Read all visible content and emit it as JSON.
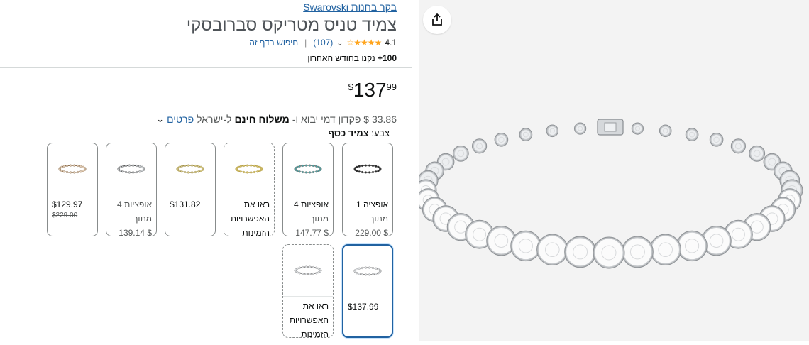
{
  "store_link": "בקר בחנות Swarovski",
  "title": "צמיד טניס מטריקס סברובסקי",
  "rating": {
    "value": "4.1",
    "stars": "★★★★☆",
    "count": "(107)",
    "search_link": "חיפוש בדף זה"
  },
  "bought": {
    "count": "100+",
    "text": "נקנו בחודש האחרון"
  },
  "price": {
    "symbol": "$",
    "whole": "137",
    "fraction": "99"
  },
  "delivery": {
    "deposit": "33.86 $ פקדון דמי יבוא ו-",
    "free_shipping": "משלוח חינם",
    "to_israel": "ל-ישראל",
    "details_link": "פרטים"
  },
  "color": {
    "label": "צבע:",
    "value": "צמיד כסף"
  },
  "swatches": [
    {
      "line1": "אופציה 1",
      "line2": "מתוך",
      "line3": "$ 229.00",
      "bead": "#2b2b2b",
      "wire": "#555"
    },
    {
      "line1": "אופציות 4",
      "line2": "מתוך",
      "line3": "$ 147.77",
      "bead": "#4aa3a3",
      "wire": "#777"
    },
    {
      "line1": "ראו את",
      "line2": "האפשרויות",
      "line3": "הזמינות",
      "bead": "#d4c36a",
      "wire": "#b29b4a"
    },
    {
      "price": "$131.82",
      "bead": "#d9cc8a",
      "wire": "#9a8a4a"
    },
    {
      "line1": "אופציות 4",
      "line2": "מתוך",
      "line3": "$ 139.14",
      "bead": "#cfd3d6",
      "wire": "#555"
    },
    {
      "price": "$129.97",
      "old": "$229.00",
      "bead": "#e4cfb8",
      "wire": "#8a6e50"
    },
    {
      "price": "$137.99",
      "bead": "#e0e3e6",
      "wire": "#888"
    },
    {
      "line1": "ראו את",
      "line2": "האפשרויות",
      "line3": "הזמינות",
      "bead": "#e0e3e6",
      "wire": "#888"
    }
  ],
  "image": {
    "alt": "Silver tennis bracelet with clear crystals"
  }
}
